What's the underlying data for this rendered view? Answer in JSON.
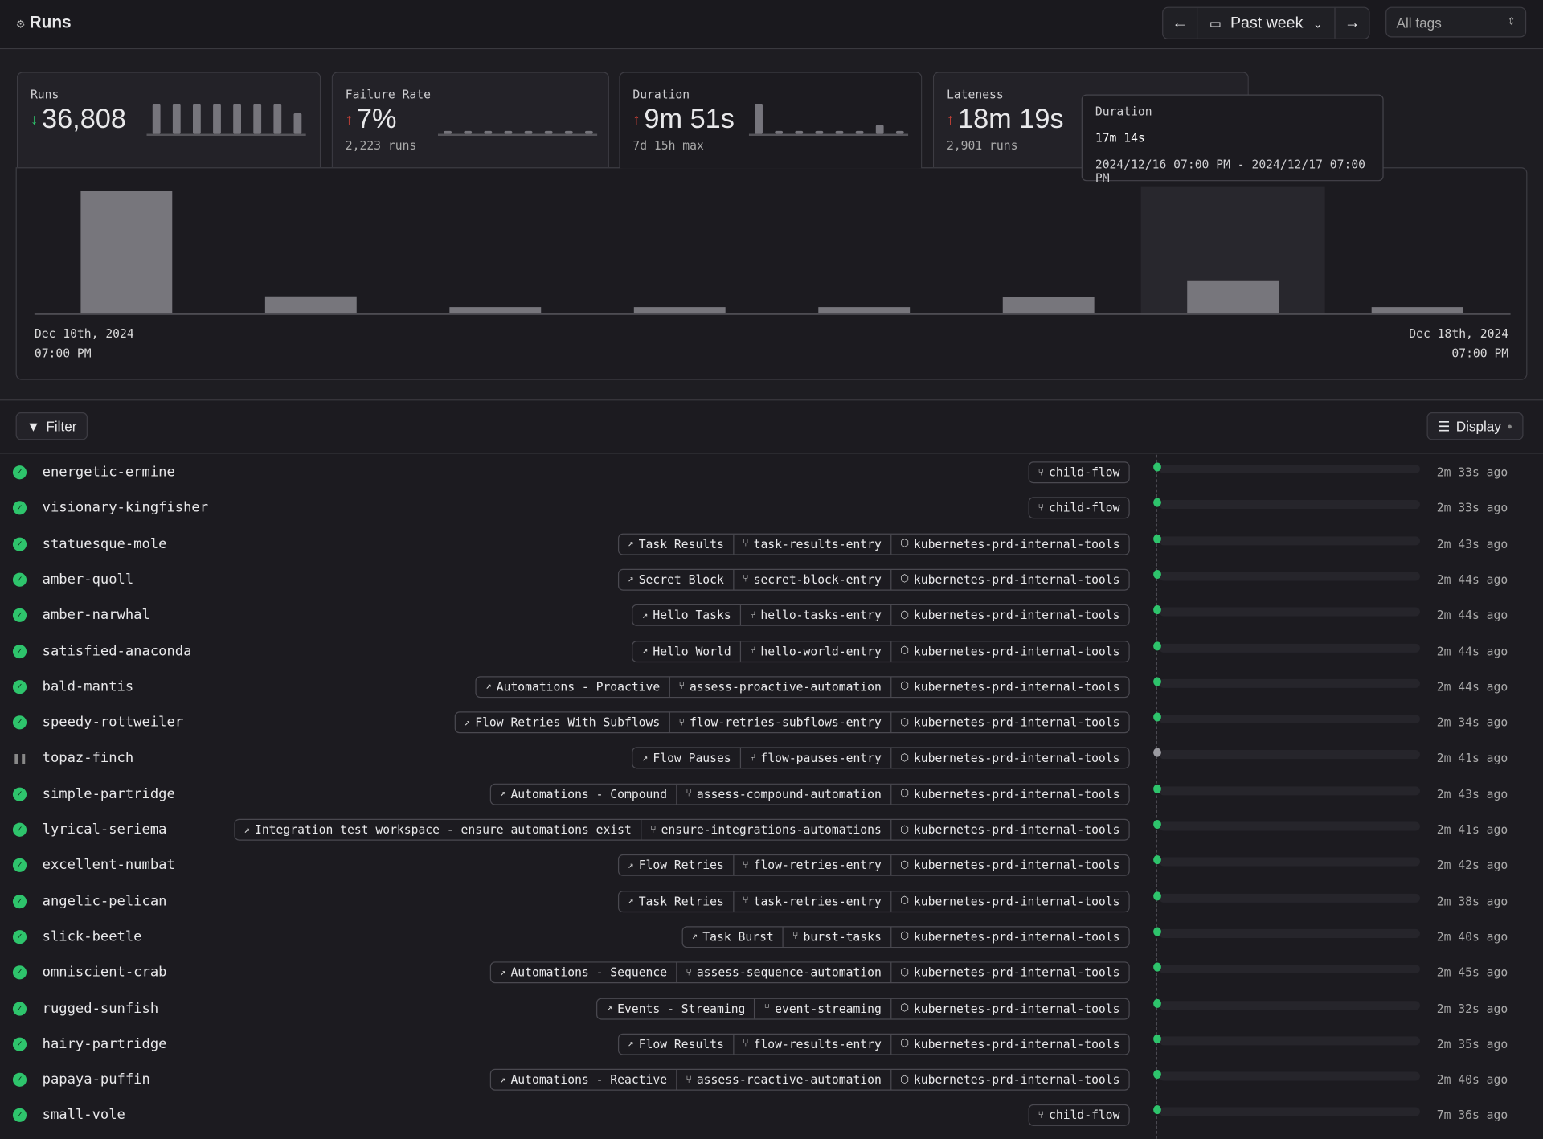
{
  "header": {
    "title": "Runs",
    "title_icon": "flow-runs-icon",
    "date_range": "Past week",
    "tags_select": "All tags"
  },
  "stats": {
    "runs": {
      "label": "Runs",
      "value": "36,808",
      "trend": "down",
      "trend_color": "#2ec46c",
      "sparkline": [
        1,
        1,
        1,
        1,
        1,
        1,
        1,
        0.7
      ]
    },
    "failure_rate": {
      "label": "Failure Rate",
      "value": "7%",
      "trend": "up",
      "trend_color": "#e0463a",
      "sub": "2,223 runs",
      "sparkline": [
        0.1,
        0.1,
        0.1,
        0.1,
        0.1,
        0.1,
        0.1,
        0.1
      ]
    },
    "duration": {
      "label": "Duration",
      "value": "9m 51s",
      "trend": "up",
      "trend_color": "#e0463a",
      "sub": "7d 15h max",
      "sparkline": [
        1,
        0.1,
        0.1,
        0.1,
        0.1,
        0.1,
        0.3,
        0.1
      ]
    },
    "lateness": {
      "label": "Lateness",
      "value": "18m 19s",
      "trend": "up",
      "trend_color": "#e0463a",
      "sub": "2,901 runs"
    }
  },
  "chart_data": {
    "type": "bar",
    "metric": "Duration",
    "x_start": [
      "Dec 10th, 2024",
      "07:00 PM"
    ],
    "x_end": [
      "Dec 18th, 2024",
      "07:00 PM"
    ],
    "values_minutes": [
      63,
      9,
      3.5,
      3.5,
      3.5,
      8.6,
      17.23,
      3.5
    ],
    "highlighted_index": 6
  },
  "tooltip": {
    "title": "Duration",
    "value": "17m 14s",
    "range": "2024/12/16 07:00 PM - 2024/12/17 07:00 PM"
  },
  "toolbar": {
    "filter": "Filter",
    "display": "Display"
  },
  "runs": [
    {
      "name": "energetic-ermine",
      "state": "completed",
      "tags": [
        [
          "flow",
          "child-flow"
        ]
      ],
      "time": "2m 33s ago"
    },
    {
      "name": "visionary-kingfisher",
      "state": "completed",
      "tags": [
        [
          "flow",
          "child-flow"
        ]
      ],
      "time": "2m 33s ago"
    },
    {
      "name": "statuesque-mole",
      "state": "completed",
      "tags": [
        [
          "deployment",
          "Task Results"
        ],
        [
          "flow",
          "task-results-entry"
        ],
        [
          "pool",
          "kubernetes-prd-internal-tools"
        ]
      ],
      "time": "2m 43s ago"
    },
    {
      "name": "amber-quoll",
      "state": "completed",
      "tags": [
        [
          "deployment",
          "Secret Block"
        ],
        [
          "flow",
          "secret-block-entry"
        ],
        [
          "pool",
          "kubernetes-prd-internal-tools"
        ]
      ],
      "time": "2m 44s ago"
    },
    {
      "name": "amber-narwhal",
      "state": "completed",
      "tags": [
        [
          "deployment",
          "Hello Tasks"
        ],
        [
          "flow",
          "hello-tasks-entry"
        ],
        [
          "pool",
          "kubernetes-prd-internal-tools"
        ]
      ],
      "time": "2m 44s ago"
    },
    {
      "name": "satisfied-anaconda",
      "state": "completed",
      "tags": [
        [
          "deployment",
          "Hello World"
        ],
        [
          "flow",
          "hello-world-entry"
        ],
        [
          "pool",
          "kubernetes-prd-internal-tools"
        ]
      ],
      "time": "2m 44s ago"
    },
    {
      "name": "bald-mantis",
      "state": "completed",
      "tags": [
        [
          "deployment",
          "Automations - Proactive"
        ],
        [
          "flow",
          "assess-proactive-automation"
        ],
        [
          "pool",
          "kubernetes-prd-internal-tools"
        ]
      ],
      "time": "2m 44s ago"
    },
    {
      "name": "speedy-rottweiler",
      "state": "completed",
      "tags": [
        [
          "deployment",
          "Flow Retries With Subflows"
        ],
        [
          "flow",
          "flow-retries-subflows-entry"
        ],
        [
          "pool",
          "kubernetes-prd-internal-tools"
        ]
      ],
      "time": "2m 34s ago"
    },
    {
      "name": "topaz-finch",
      "state": "paused",
      "tags": [
        [
          "deployment",
          "Flow Pauses"
        ],
        [
          "flow",
          "flow-pauses-entry"
        ],
        [
          "pool",
          "kubernetes-prd-internal-tools"
        ]
      ],
      "time": "2m 41s ago"
    },
    {
      "name": "simple-partridge",
      "state": "completed",
      "tags": [
        [
          "deployment",
          "Automations - Compound"
        ],
        [
          "flow",
          "assess-compound-automation"
        ],
        [
          "pool",
          "kubernetes-prd-internal-tools"
        ]
      ],
      "time": "2m 43s ago"
    },
    {
      "name": "lyrical-seriema",
      "state": "completed",
      "tags": [
        [
          "deployment",
          "Integration test workspace - ensure automations exist"
        ],
        [
          "flow",
          "ensure-integrations-automations"
        ],
        [
          "pool",
          "kubernetes-prd-internal-tools"
        ]
      ],
      "time": "2m 41s ago"
    },
    {
      "name": "excellent-numbat",
      "state": "completed",
      "tags": [
        [
          "deployment",
          "Flow Retries"
        ],
        [
          "flow",
          "flow-retries-entry"
        ],
        [
          "pool",
          "kubernetes-prd-internal-tools"
        ]
      ],
      "time": "2m 42s ago"
    },
    {
      "name": "angelic-pelican",
      "state": "completed",
      "tags": [
        [
          "deployment",
          "Task Retries"
        ],
        [
          "flow",
          "task-retries-entry"
        ],
        [
          "pool",
          "kubernetes-prd-internal-tools"
        ]
      ],
      "time": "2m 38s ago"
    },
    {
      "name": "slick-beetle",
      "state": "completed",
      "tags": [
        [
          "deployment",
          "Task Burst"
        ],
        [
          "flow",
          "burst-tasks"
        ],
        [
          "pool",
          "kubernetes-prd-internal-tools"
        ]
      ],
      "time": "2m 40s ago"
    },
    {
      "name": "omniscient-crab",
      "state": "completed",
      "tags": [
        [
          "deployment",
          "Automations - Sequence"
        ],
        [
          "flow",
          "assess-sequence-automation"
        ],
        [
          "pool",
          "kubernetes-prd-internal-tools"
        ]
      ],
      "time": "2m 45s ago"
    },
    {
      "name": "rugged-sunfish",
      "state": "completed",
      "tags": [
        [
          "deployment",
          "Events - Streaming"
        ],
        [
          "flow",
          "event-streaming"
        ],
        [
          "pool",
          "kubernetes-prd-internal-tools"
        ]
      ],
      "time": "2m 32s ago"
    },
    {
      "name": "hairy-partridge",
      "state": "completed",
      "tags": [
        [
          "deployment",
          "Flow Results"
        ],
        [
          "flow",
          "flow-results-entry"
        ],
        [
          "pool",
          "kubernetes-prd-internal-tools"
        ]
      ],
      "time": "2m 35s ago"
    },
    {
      "name": "papaya-puffin",
      "state": "completed",
      "tags": [
        [
          "deployment",
          "Automations - Reactive"
        ],
        [
          "flow",
          "assess-reactive-automation"
        ],
        [
          "pool",
          "kubernetes-prd-internal-tools"
        ]
      ],
      "time": "2m 40s ago"
    },
    {
      "name": "small-vole",
      "state": "completed",
      "tags": [
        [
          "flow",
          "child-flow"
        ]
      ],
      "time": "7m 36s ago"
    }
  ]
}
